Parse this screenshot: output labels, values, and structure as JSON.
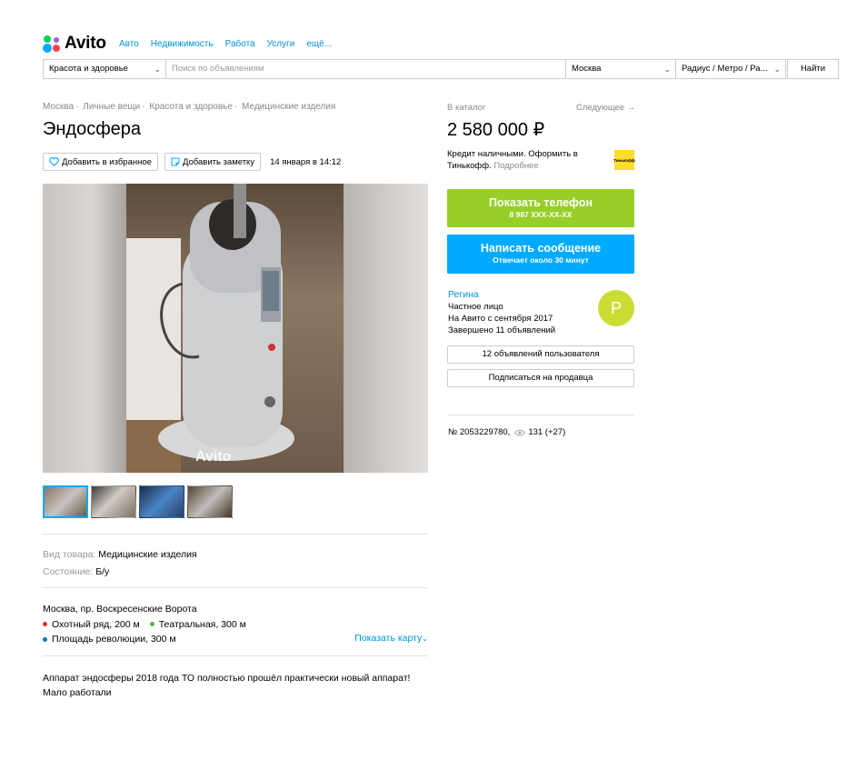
{
  "header": {
    "logo_text": "Avito",
    "nav": [
      "Авто",
      "Недвижимость",
      "Работа",
      "Услуги",
      "ещё..."
    ]
  },
  "search": {
    "category": "Красота и здоровье",
    "placeholder": "Поиск по объявлениям",
    "city": "Москва",
    "radius": "Радиус / Метро / Ра...",
    "button": "Найти"
  },
  "breadcrumb": [
    "Москва",
    "Личные вещи",
    "Красота и здоровье",
    "Медицинские изделия"
  ],
  "title": "Эндосфера",
  "actions": {
    "favorite": "Добавить в избранное",
    "note": "Добавить заметку",
    "date": "14 января в 14:12"
  },
  "photo": {
    "watermark": "Avito"
  },
  "params": [
    {
      "key": "Вид товара:",
      "value": "Медицинские изделия"
    },
    {
      "key": "Состояние:",
      "value": "Б/у"
    }
  ],
  "address": {
    "line": "Москва, пр. Воскресенские Ворота",
    "metro": [
      {
        "name": "Охотный ряд, 200 м",
        "color": "#e4282c"
      },
      {
        "name": "Театральная, 300 м",
        "color": "#4fb04f"
      },
      {
        "name": "Площадь революции, 300 м",
        "color": "#0078be"
      }
    ],
    "map_link": "Показать карту"
  },
  "description": "Аппарат эндосферы 2018 года ТО полностью прошёл практически новый аппарат! Мало работали",
  "right": {
    "catalog": "В каталог",
    "next": "Следующее →",
    "price": "2 580 000 ₽",
    "credit_text": "Кредит наличными. Оформить в Тинькофф.",
    "credit_more": "Подробнее",
    "tinkoff_label": "Тинькофф",
    "phone_title": "Показать телефон",
    "phone_number": "8 987 XXX-XX-XX",
    "msg_title": "Написать сообщение",
    "msg_sub": "Отвечает около 30 минут"
  },
  "seller": {
    "name": "Регина",
    "type": "Частное лицо",
    "since": "На Авито с сентября 2017",
    "completed": "Завершено 11 объявлений",
    "avatar_letter": "Р",
    "ads_button": "12 объявлений пользователя",
    "subscribe_button": "Подписаться на продавца"
  },
  "ad_info": {
    "number": "№ 2053229780,",
    "views": "131 (+27)"
  },
  "colors": {
    "link": "#0091d9",
    "green_button": "#97cf26",
    "blue_button": "#00aaff",
    "avatar": "#cbdc35"
  }
}
